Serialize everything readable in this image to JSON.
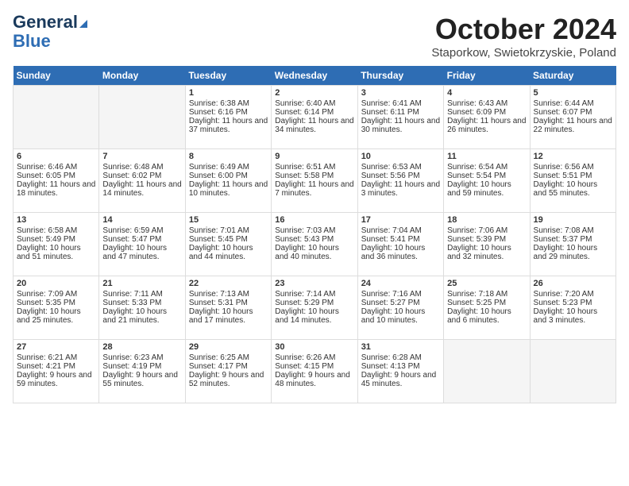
{
  "logo": {
    "line1": "General",
    "line2": "Blue"
  },
  "title": "October 2024",
  "subtitle": "Staporkow, Swietokrzyskie, Poland",
  "days": [
    "Sunday",
    "Monday",
    "Tuesday",
    "Wednesday",
    "Thursday",
    "Friday",
    "Saturday"
  ],
  "weeks": [
    [
      {
        "num": "",
        "sunrise": "",
        "sunset": "",
        "daylight": "",
        "empty": true
      },
      {
        "num": "",
        "sunrise": "",
        "sunset": "",
        "daylight": "",
        "empty": true
      },
      {
        "num": "1",
        "sunrise": "Sunrise: 6:38 AM",
        "sunset": "Sunset: 6:16 PM",
        "daylight": "Daylight: 11 hours and 37 minutes."
      },
      {
        "num": "2",
        "sunrise": "Sunrise: 6:40 AM",
        "sunset": "Sunset: 6:14 PM",
        "daylight": "Daylight: 11 hours and 34 minutes."
      },
      {
        "num": "3",
        "sunrise": "Sunrise: 6:41 AM",
        "sunset": "Sunset: 6:11 PM",
        "daylight": "Daylight: 11 hours and 30 minutes."
      },
      {
        "num": "4",
        "sunrise": "Sunrise: 6:43 AM",
        "sunset": "Sunset: 6:09 PM",
        "daylight": "Daylight: 11 hours and 26 minutes."
      },
      {
        "num": "5",
        "sunrise": "Sunrise: 6:44 AM",
        "sunset": "Sunset: 6:07 PM",
        "daylight": "Daylight: 11 hours and 22 minutes."
      }
    ],
    [
      {
        "num": "6",
        "sunrise": "Sunrise: 6:46 AM",
        "sunset": "Sunset: 6:05 PM",
        "daylight": "Daylight: 11 hours and 18 minutes."
      },
      {
        "num": "7",
        "sunrise": "Sunrise: 6:48 AM",
        "sunset": "Sunset: 6:02 PM",
        "daylight": "Daylight: 11 hours and 14 minutes."
      },
      {
        "num": "8",
        "sunrise": "Sunrise: 6:49 AM",
        "sunset": "Sunset: 6:00 PM",
        "daylight": "Daylight: 11 hours and 10 minutes."
      },
      {
        "num": "9",
        "sunrise": "Sunrise: 6:51 AM",
        "sunset": "Sunset: 5:58 PM",
        "daylight": "Daylight: 11 hours and 7 minutes."
      },
      {
        "num": "10",
        "sunrise": "Sunrise: 6:53 AM",
        "sunset": "Sunset: 5:56 PM",
        "daylight": "Daylight: 11 hours and 3 minutes."
      },
      {
        "num": "11",
        "sunrise": "Sunrise: 6:54 AM",
        "sunset": "Sunset: 5:54 PM",
        "daylight": "Daylight: 10 hours and 59 minutes."
      },
      {
        "num": "12",
        "sunrise": "Sunrise: 6:56 AM",
        "sunset": "Sunset: 5:51 PM",
        "daylight": "Daylight: 10 hours and 55 minutes."
      }
    ],
    [
      {
        "num": "13",
        "sunrise": "Sunrise: 6:58 AM",
        "sunset": "Sunset: 5:49 PM",
        "daylight": "Daylight: 10 hours and 51 minutes."
      },
      {
        "num": "14",
        "sunrise": "Sunrise: 6:59 AM",
        "sunset": "Sunset: 5:47 PM",
        "daylight": "Daylight: 10 hours and 47 minutes."
      },
      {
        "num": "15",
        "sunrise": "Sunrise: 7:01 AM",
        "sunset": "Sunset: 5:45 PM",
        "daylight": "Daylight: 10 hours and 44 minutes."
      },
      {
        "num": "16",
        "sunrise": "Sunrise: 7:03 AM",
        "sunset": "Sunset: 5:43 PM",
        "daylight": "Daylight: 10 hours and 40 minutes."
      },
      {
        "num": "17",
        "sunrise": "Sunrise: 7:04 AM",
        "sunset": "Sunset: 5:41 PM",
        "daylight": "Daylight: 10 hours and 36 minutes."
      },
      {
        "num": "18",
        "sunrise": "Sunrise: 7:06 AM",
        "sunset": "Sunset: 5:39 PM",
        "daylight": "Daylight: 10 hours and 32 minutes."
      },
      {
        "num": "19",
        "sunrise": "Sunrise: 7:08 AM",
        "sunset": "Sunset: 5:37 PM",
        "daylight": "Daylight: 10 hours and 29 minutes."
      }
    ],
    [
      {
        "num": "20",
        "sunrise": "Sunrise: 7:09 AM",
        "sunset": "Sunset: 5:35 PM",
        "daylight": "Daylight: 10 hours and 25 minutes."
      },
      {
        "num": "21",
        "sunrise": "Sunrise: 7:11 AM",
        "sunset": "Sunset: 5:33 PM",
        "daylight": "Daylight: 10 hours and 21 minutes."
      },
      {
        "num": "22",
        "sunrise": "Sunrise: 7:13 AM",
        "sunset": "Sunset: 5:31 PM",
        "daylight": "Daylight: 10 hours and 17 minutes."
      },
      {
        "num": "23",
        "sunrise": "Sunrise: 7:14 AM",
        "sunset": "Sunset: 5:29 PM",
        "daylight": "Daylight: 10 hours and 14 minutes."
      },
      {
        "num": "24",
        "sunrise": "Sunrise: 7:16 AM",
        "sunset": "Sunset: 5:27 PM",
        "daylight": "Daylight: 10 hours and 10 minutes."
      },
      {
        "num": "25",
        "sunrise": "Sunrise: 7:18 AM",
        "sunset": "Sunset: 5:25 PM",
        "daylight": "Daylight: 10 hours and 6 minutes."
      },
      {
        "num": "26",
        "sunrise": "Sunrise: 7:20 AM",
        "sunset": "Sunset: 5:23 PM",
        "daylight": "Daylight: 10 hours and 3 minutes."
      }
    ],
    [
      {
        "num": "27",
        "sunrise": "Sunrise: 6:21 AM",
        "sunset": "Sunset: 4:21 PM",
        "daylight": "Daylight: 9 hours and 59 minutes."
      },
      {
        "num": "28",
        "sunrise": "Sunrise: 6:23 AM",
        "sunset": "Sunset: 4:19 PM",
        "daylight": "Daylight: 9 hours and 55 minutes."
      },
      {
        "num": "29",
        "sunrise": "Sunrise: 6:25 AM",
        "sunset": "Sunset: 4:17 PM",
        "daylight": "Daylight: 9 hours and 52 minutes."
      },
      {
        "num": "30",
        "sunrise": "Sunrise: 6:26 AM",
        "sunset": "Sunset: 4:15 PM",
        "daylight": "Daylight: 9 hours and 48 minutes."
      },
      {
        "num": "31",
        "sunrise": "Sunrise: 6:28 AM",
        "sunset": "Sunset: 4:13 PM",
        "daylight": "Daylight: 9 hours and 45 minutes."
      },
      {
        "num": "",
        "sunrise": "",
        "sunset": "",
        "daylight": "",
        "empty": true
      },
      {
        "num": "",
        "sunrise": "",
        "sunset": "",
        "daylight": "",
        "empty": true
      }
    ]
  ]
}
